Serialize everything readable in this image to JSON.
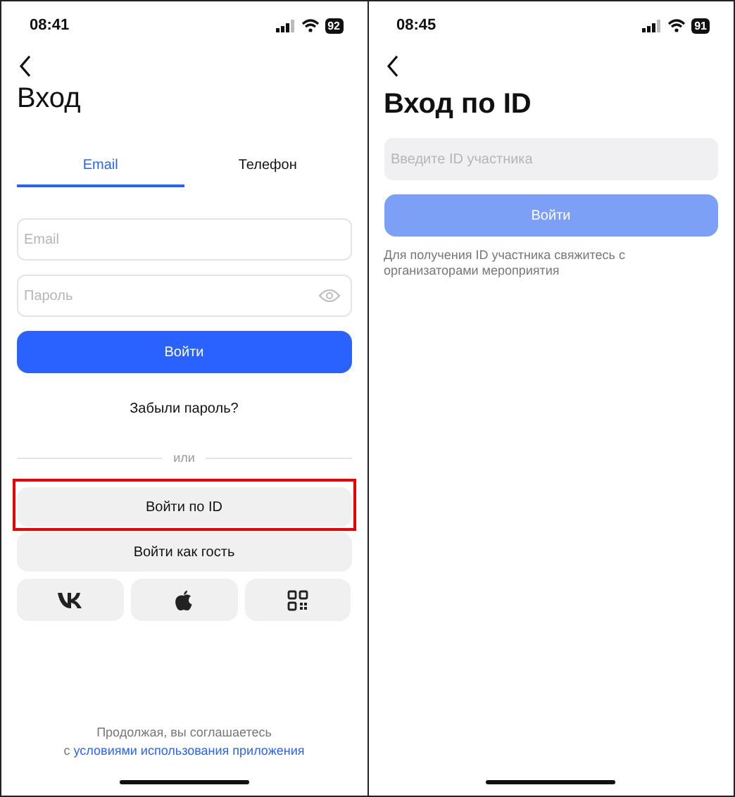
{
  "screens": [
    {
      "status_bar": {
        "time": "08:41",
        "battery": "92"
      },
      "title": "Вход",
      "tabs": [
        {
          "label": "Email",
          "selected": true
        },
        {
          "label": "Телефон",
          "selected": false
        }
      ],
      "fields": [
        {
          "placeholder": "Email",
          "kind": "text"
        },
        {
          "placeholder": "Пароль",
          "kind": "password"
        }
      ],
      "login_button": {
        "label": "Войти",
        "disabled": false
      },
      "forgot_link": "Забыли пароль?",
      "divider_text": "или",
      "buttons": [
        {
          "label": "Войти по ID",
          "highlighted": true
        },
        {
          "label": "Войти как гость",
          "highlighted": false
        }
      ],
      "social_buttons": [
        {
          "kind": "vk"
        },
        {
          "kind": "apple"
        },
        {
          "kind": "qr"
        }
      ],
      "footer": {
        "text": "Продолжая, вы соглашаетесь",
        "prefix": "с",
        "link": "условиями использования приложения"
      }
    },
    {
      "status_bar": {
        "time": "08:45",
        "battery": "91"
      },
      "title": "Вход по ID",
      "fields": [
        {
          "placeholder": "Введите ID участника",
          "kind": "filled"
        }
      ],
      "login_button": {
        "label": "Войти",
        "disabled": true
      },
      "hint": "Для получения ID участника свяжитесь с организаторами мероприятия"
    }
  ]
}
